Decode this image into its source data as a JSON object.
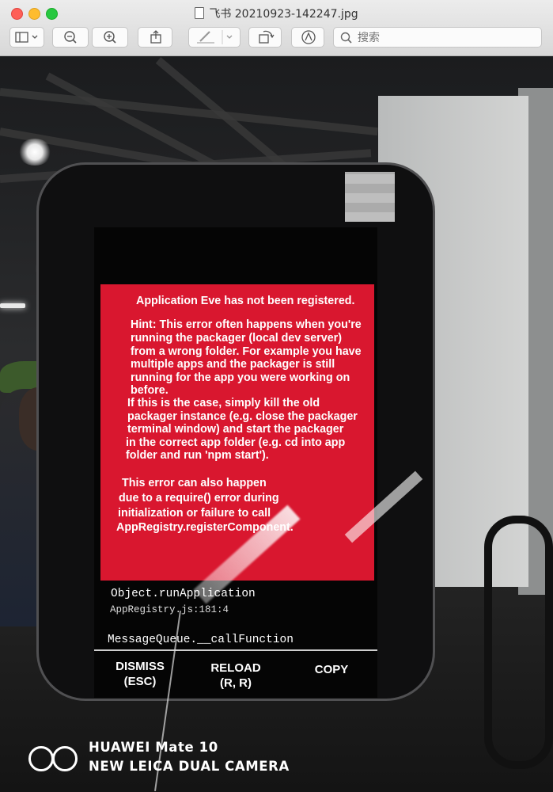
{
  "window": {
    "title": "飞书 20210923-142247.jpg",
    "search_placeholder": "搜索"
  },
  "toolbar": {
    "items": [
      "sidebar-toggle",
      "zoom-out",
      "zoom-in",
      "share",
      "markup",
      "rotate",
      "annotate"
    ]
  },
  "error_screen": {
    "title": "Application Eve has not been registered.",
    "hint_lines": [
      "Hint: This error often happens when you're",
      "running the packager (local dev server)",
      "from a wrong folder. For example you have",
      "multiple apps and the packager is still",
      "running for the app you were working on",
      "before.",
      "If this is the case, simply kill the old",
      "packager instance (e.g. close the packager",
      "terminal window) and start the packager",
      "in the correct app folder (e.g. cd into app",
      "folder and run 'npm start')."
    ],
    "also_lines": [
      "This error can also happen",
      "due to a require() error during",
      "initialization or failure to call",
      "AppRegistry.registerComponent."
    ],
    "stack": [
      {
        "func": "Object.runApplication",
        "loc": "AppRegistry.js:181:4"
      },
      {
        "func": "MessageQueue.__callFunction",
        "loc": ""
      }
    ],
    "buttons": {
      "dismiss": "DISMISS\n(ESC)",
      "reload": "RELOAD\n(R, R)",
      "copy": "COPY"
    }
  },
  "camera_watermark": {
    "line1": "HUAWEI Mate 10",
    "line2": "NEW LEICA DUAL CAMERA"
  },
  "colors": {
    "error_red": "#d9172f",
    "titlebar": "#e3e3e3"
  }
}
